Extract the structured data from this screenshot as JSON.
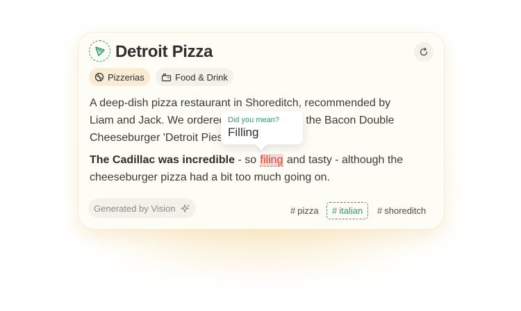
{
  "place": {
    "title": "Detroit Pizza",
    "icon": "pizza-slice-icon",
    "refresh_icon": "refresh-icon"
  },
  "categories": [
    {
      "label": "Pizzerias",
      "icon": "pizza-icon"
    },
    {
      "label": "Food & Drink",
      "icon": "restaurant-icon"
    }
  ],
  "description": {
    "p1_line1": "A deep-dish pizza restaurant in Shoreditch, recommended by",
    "p1_line2_a": "Liam and Jack. We ordered",
    "p1_line2_b": "l the Bacon Double",
    "p1_line3_a": "Cheeseburger 'Detroit Pies",
    "p2_bold": "The Cadillac was incredible",
    "p2_a": " - so ",
    "p2_typo": "filing",
    "p2_b": " and tasty - although the",
    "p2_line2": "cheeseburger pizza had a bit too much going on."
  },
  "spellcheck": {
    "label": "Did you mean?",
    "suggestion": "Filling"
  },
  "footer": {
    "generated_label": "Generated by Vision",
    "generated_icon": "sparkles-icon"
  },
  "tags": [
    {
      "text": "pizza",
      "selected": false
    },
    {
      "text": "italian",
      "selected": true
    },
    {
      "text": "shoreditch",
      "selected": false
    }
  ],
  "colors": {
    "accent": "#2f9a6e",
    "typo_bg": "#f8d7d3",
    "typo_text": "#c94a3e",
    "card_bg": "#fdfcf5",
    "chip_highlight": "#f8ecd4"
  }
}
